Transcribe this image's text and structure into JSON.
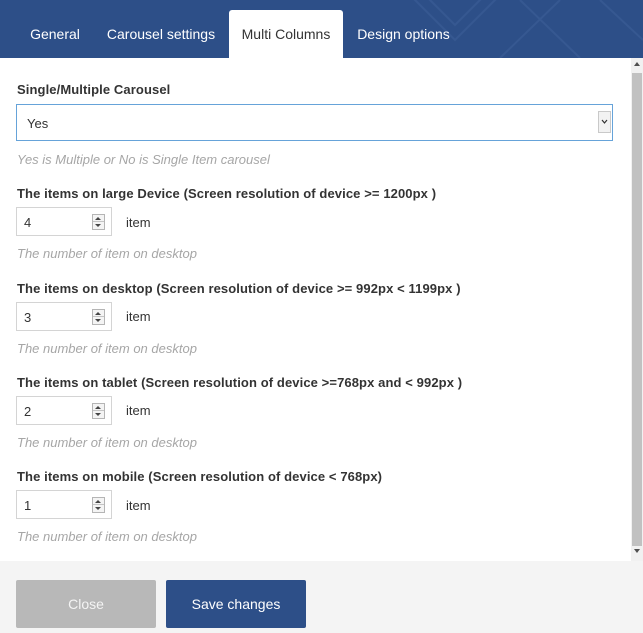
{
  "tabs": [
    {
      "label": "General"
    },
    {
      "label": "Carousel settings"
    },
    {
      "label": "Multi Columns"
    },
    {
      "label": "Design options"
    }
  ],
  "active_tab": "Multi Columns",
  "carousel": {
    "label": "Single/Multiple Carousel",
    "value": "Yes",
    "help": "Yes is Multiple or No is Single Item carousel"
  },
  "fields": [
    {
      "label": "The items on large Device (Screen resolution of device >= 1200px )",
      "value": "4",
      "unit": "item",
      "help": "The number of item on desktop"
    },
    {
      "label": "The items on desktop (Screen resolution of device >= 992px < 1199px )",
      "value": "3",
      "unit": "item",
      "help": "The number of item on desktop"
    },
    {
      "label": "The items on tablet (Screen resolution of device >=768px and < 992px )",
      "value": "2",
      "unit": "item",
      "help": "The number of item on desktop"
    },
    {
      "label": "The items on mobile (Screen resolution of device < 768px)",
      "value": "1",
      "unit": "item",
      "help": "The number of item on desktop"
    }
  ],
  "footer": {
    "close_label": "Close",
    "save_label": "Save changes"
  },
  "colors": {
    "header": "#2d4f88",
    "save_button": "#2d4f88",
    "close_button": "#b8b8b8",
    "help_text": "#a6a6a6",
    "select_border": "#66a3d9"
  }
}
